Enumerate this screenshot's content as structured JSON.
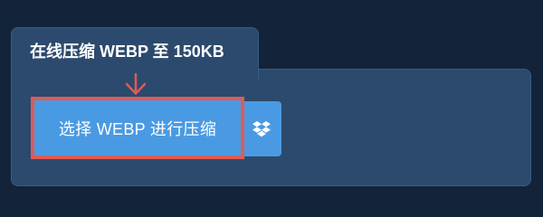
{
  "panel": {
    "title": "在线压缩 WEBP 至 150KB"
  },
  "upload": {
    "choose_label": "选择 WEBP 进行压缩",
    "dropbox_icon": "dropbox-icon"
  },
  "colors": {
    "background": "#13233a",
    "panel": "#2c4a6d",
    "button": "#4a9ae3",
    "highlight": "#de5b55"
  }
}
